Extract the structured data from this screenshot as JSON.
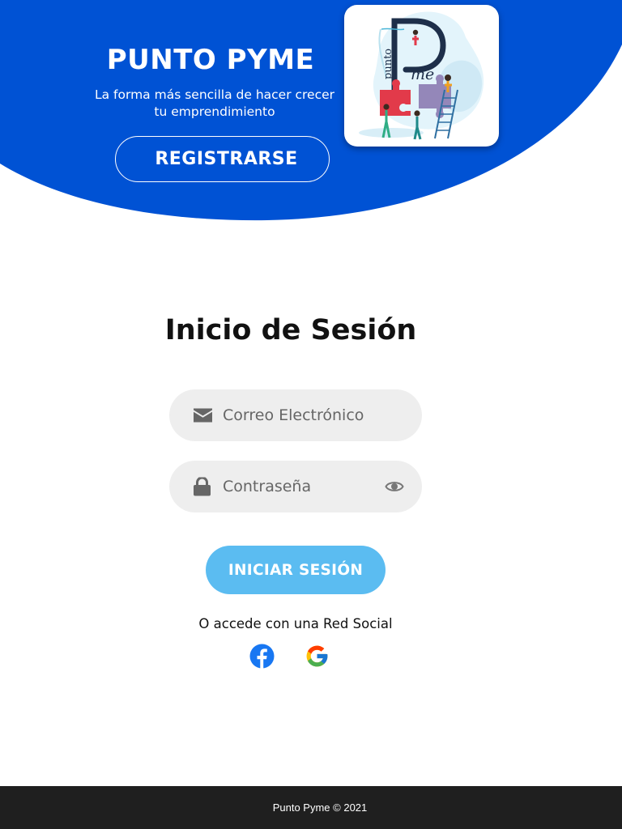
{
  "colors": {
    "hero_blue": "#0052d4",
    "submit_blue": "#5bbcf1",
    "field_gray": "#eeeeee",
    "footer_dark": "#1f1f1f"
  },
  "hero": {
    "title": "PUNTO PYME",
    "subtitle": "La forma más sencilla de hacer crecer tu emprendimiento",
    "register_label": "REGISTRARSE"
  },
  "login": {
    "title": "Inicio de Sesión",
    "email_placeholder": "Correo Electrónico",
    "password_placeholder": "Contraseña",
    "submit_label": "INICIAR SESIÓN",
    "social_prompt": "O accede con una Red Social",
    "icons": {
      "email": "envelope-icon",
      "password": "lock-icon",
      "toggle": "eye-icon",
      "social": [
        "facebook-icon",
        "google-icon"
      ]
    }
  },
  "footer": {
    "text": "Punto Pyme © 2021"
  }
}
